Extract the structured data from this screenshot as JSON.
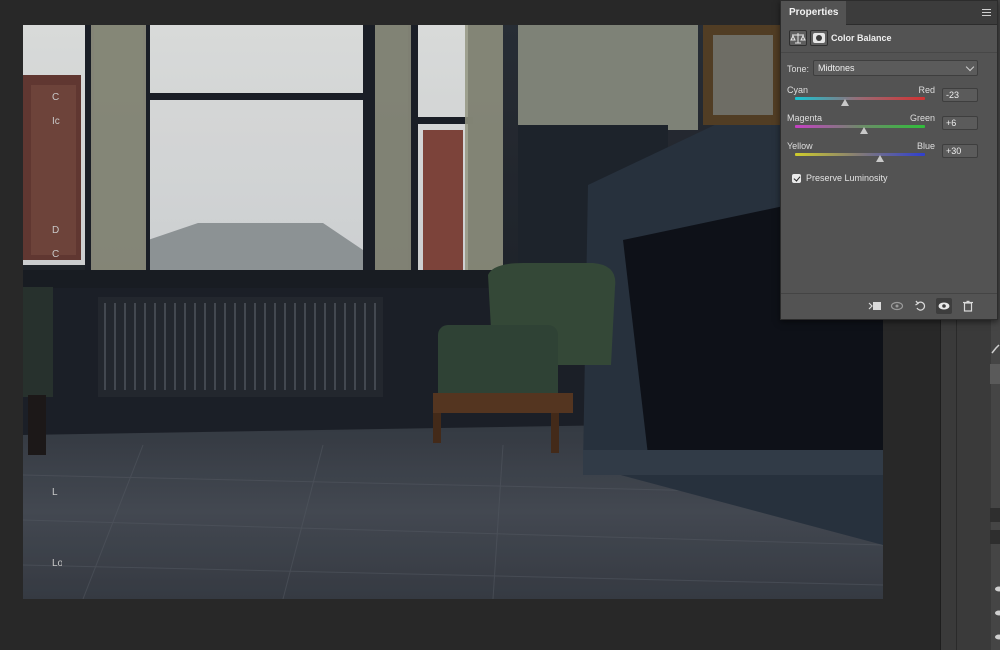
{
  "panel": {
    "tab_title": "Properties",
    "adjustment_title": "Color Balance",
    "tone_label": "Tone:",
    "tone_value": "Midtones",
    "sliders": [
      {
        "left": "Cyan",
        "right": "Red",
        "value": "-23",
        "level": -23,
        "gradient": [
          "#16c4d2",
          "#9a6a74",
          "#d23232"
        ]
      },
      {
        "left": "Magenta",
        "right": "Green",
        "value": "+6",
        "level": 6,
        "gradient": [
          "#c63fc4",
          "#6e8a6a",
          "#2fbf3a"
        ]
      },
      {
        "left": "Yellow",
        "right": "Blue",
        "value": "+30",
        "level": 30,
        "gradient": [
          "#cfcc2b",
          "#827a78",
          "#2f3fcf"
        ]
      }
    ],
    "preserve_luminosity": {
      "label": "Preserve Luminosity",
      "checked": true
    },
    "footer_icons": [
      "clip-to-layer-icon",
      "view-previous-icon",
      "reset-icon",
      "visibility-eye-icon",
      "delete-trash-icon"
    ]
  },
  "right_dock": {
    "fragments": [
      "C",
      "Ic",
      "",
      "",
      "",
      "D",
      "C",
      "",
      "",
      "",
      "L",
      "",
      "",
      "",
      "Lo"
    ]
  },
  "colors": {
    "panel_bg": "#535353",
    "canvas_bg": "#282828",
    "accent": "#e9e9e9"
  }
}
